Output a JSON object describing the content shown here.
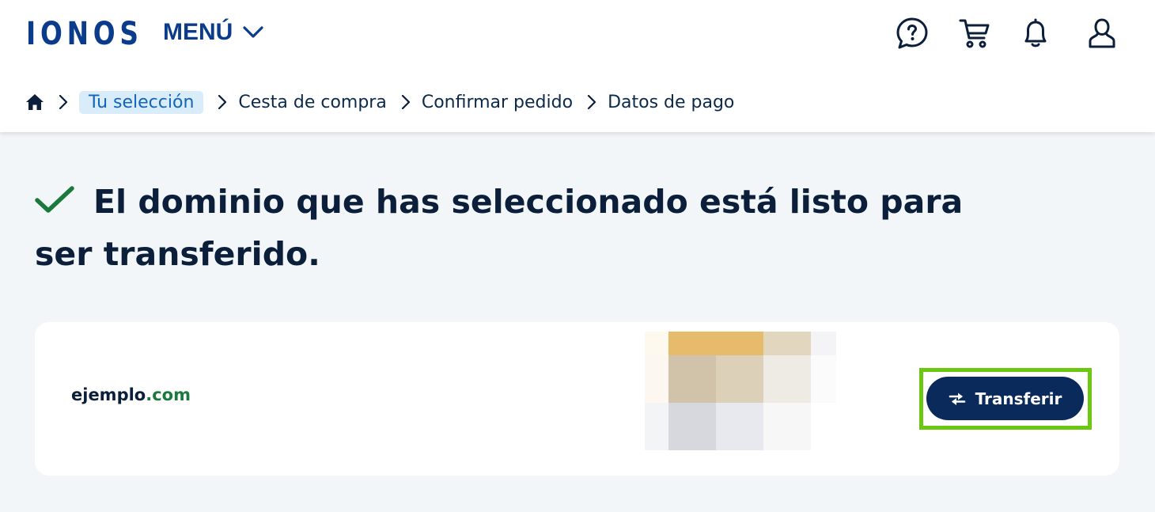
{
  "header": {
    "logo": "IONOS",
    "menu_label": "MENÚ",
    "icons": [
      "help-chat-icon",
      "cart-icon",
      "bell-icon",
      "user-icon"
    ]
  },
  "breadcrumb": {
    "home_icon": "home-icon",
    "items": [
      "Tu selección",
      "Cesta de compra",
      "Confirmar pedido",
      "Datos de pago"
    ],
    "active_index": 0
  },
  "main": {
    "title": "El dominio que has seleccionado está listo para ser transferido.",
    "check_icon": "checkmark-icon"
  },
  "domain_card": {
    "domain_name": "ejemplo",
    "domain_tld": ".com",
    "button_label": "Transferir",
    "button_icon": "transfer-arrows-icon"
  },
  "colors": {
    "brand_blue": "#0b3c8c",
    "button_navy": "#0b2a5c",
    "success_green": "#1a7a3d",
    "highlight_green": "#6ac90f",
    "breadcrumb_active_bg": "#d9ecf9"
  }
}
